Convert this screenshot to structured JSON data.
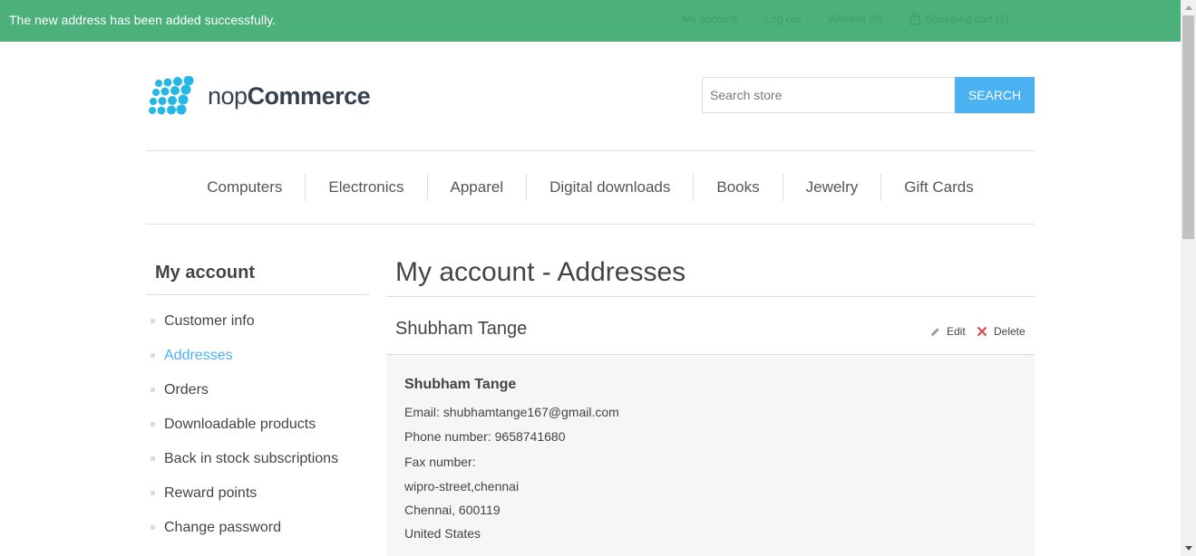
{
  "notification": {
    "message": "The new address has been added successfully.",
    "close_icon": "close-icon"
  },
  "header_links": {
    "my_account": "My account",
    "log_out": "Log out",
    "wishlist": "Wishlist (0)",
    "shopping_cart": "Shopping cart (1)"
  },
  "logo": {
    "text_light": "nop",
    "text_bold": "Commerce",
    "brand_color": "#27b7e6"
  },
  "search": {
    "placeholder": "Search store",
    "button_label": "SEARCH"
  },
  "menu": {
    "items": [
      "Computers",
      "Electronics",
      "Apparel",
      "Digital downloads",
      "Books",
      "Jewelry",
      "Gift Cards"
    ]
  },
  "sidebar": {
    "title": "My account",
    "items": [
      {
        "label": "Customer info",
        "active": false
      },
      {
        "label": "Addresses",
        "active": true
      },
      {
        "label": "Orders",
        "active": false
      },
      {
        "label": "Downloadable products",
        "active": false
      },
      {
        "label": "Back in stock subscriptions",
        "active": false
      },
      {
        "label": "Reward points",
        "active": false
      },
      {
        "label": "Change password",
        "active": false
      }
    ]
  },
  "main": {
    "page_title": "My account - Addresses",
    "address": {
      "title": "Shubham Tange",
      "edit_label": "Edit",
      "delete_label": "Delete",
      "full_name": "Shubham Tange",
      "email_label": "Email:",
      "email": "shubhamtange167@gmail.com",
      "phone_label": "Phone number:",
      "phone": "9658741680",
      "fax_label": "Fax number:",
      "fax": "",
      "street": "wipro-street,chennai",
      "city_zip": "Chennai, 600119",
      "country": "United States"
    }
  },
  "colors": {
    "notification_bg": "#4bb07a",
    "accent": "#4ab2f1",
    "delete_icon": "#e4444c"
  }
}
